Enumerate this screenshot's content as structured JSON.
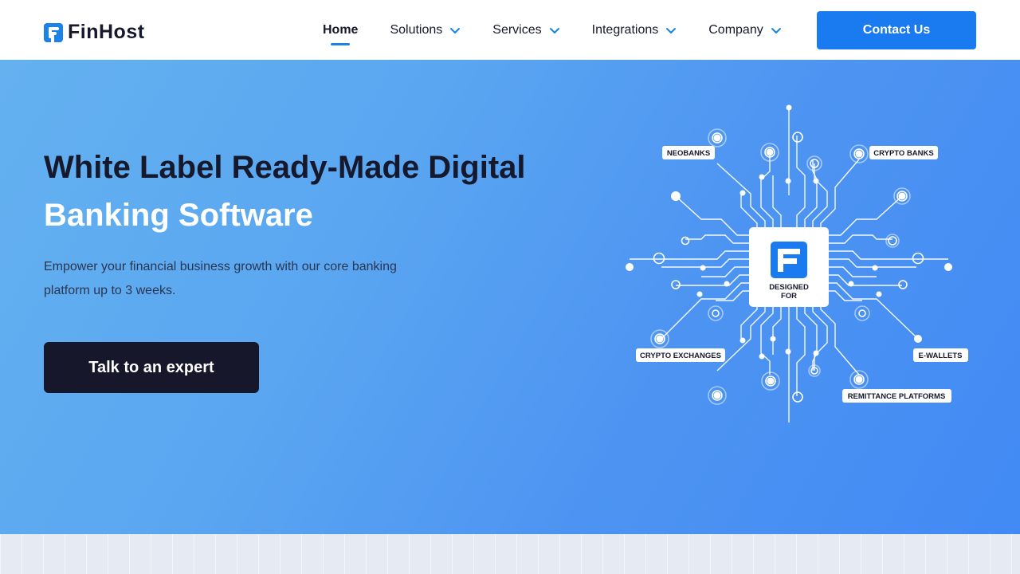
{
  "brand": {
    "name": "FinHost"
  },
  "nav": {
    "items": [
      {
        "label": "Home",
        "active": true,
        "dropdown": false
      },
      {
        "label": "Solutions",
        "active": false,
        "dropdown": true
      },
      {
        "label": "Services",
        "active": false,
        "dropdown": true
      },
      {
        "label": "Integrations",
        "active": false,
        "dropdown": true
      },
      {
        "label": "Company",
        "active": false,
        "dropdown": true
      }
    ],
    "contact_label": "Contact Us"
  },
  "hero": {
    "title_line1": "White Label Ready-Made Digital",
    "title_line2": "Banking Software",
    "subtitle": "Empower your financial business growth with our core banking platform up to 3 weeks.",
    "cta_label": "Talk to an expert"
  },
  "diagram": {
    "center_label_1": "DESIGNED",
    "center_label_2": "FOR",
    "tags": {
      "neobanks": "NEOBANKS",
      "crypto_banks": "CRYPTO BANKS",
      "crypto_exchanges": "CRYPTO EXCHANGES",
      "e_wallets": "E-WALLETS",
      "remittance": "REMITTANCE PLATFORMS"
    }
  },
  "colors": {
    "accent": "#1a7af0",
    "dark": "#16192c",
    "hero_start": "#64b1f0",
    "hero_end": "#428af4"
  },
  "icons": {
    "logo": "finhost-logo-icon",
    "chevron": "chevron-down-icon",
    "chip": "circuit-chip-icon"
  }
}
